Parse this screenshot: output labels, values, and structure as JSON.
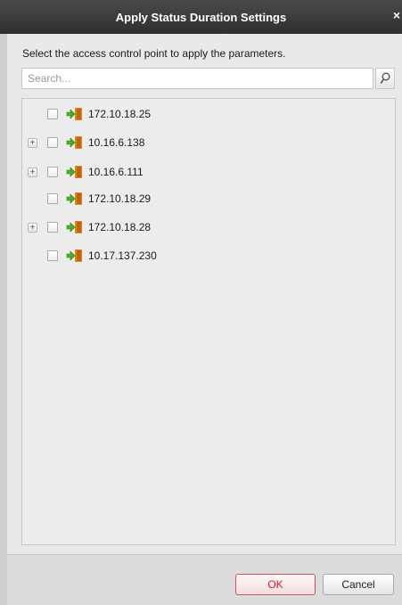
{
  "dialog": {
    "title": "Apply Status Duration Settings",
    "close_glyph": "×",
    "instruction": "Select the access control point to apply the parameters.",
    "search": {
      "placeholder": "Search...",
      "value": "",
      "icon": "search-icon"
    },
    "tree": {
      "nodes": [
        {
          "label": "172.10.18.25",
          "expandable": false,
          "checked": false,
          "icon": "door-icon"
        },
        {
          "label": "10.16.6.138",
          "expandable": true,
          "checked": false,
          "icon": "door-icon"
        },
        {
          "label": "10.16.6.111",
          "expandable": true,
          "checked": false,
          "icon": "door-icon"
        },
        {
          "label": "172.10.18.29",
          "expandable": false,
          "checked": false,
          "icon": "door-icon"
        },
        {
          "label": "172.10.18.28",
          "expandable": true,
          "checked": false,
          "icon": "door-icon"
        },
        {
          "label": "10.17.137.230",
          "expandable": false,
          "checked": false,
          "icon": "door-icon"
        }
      ]
    },
    "buttons": {
      "ok_label": "OK",
      "cancel_label": "Cancel"
    },
    "colors": {
      "titlebar": "#3a3a3a",
      "ok_accent": "#d01e1e",
      "door_green": "#4caf2a",
      "door_orange": "#d9861c"
    }
  }
}
